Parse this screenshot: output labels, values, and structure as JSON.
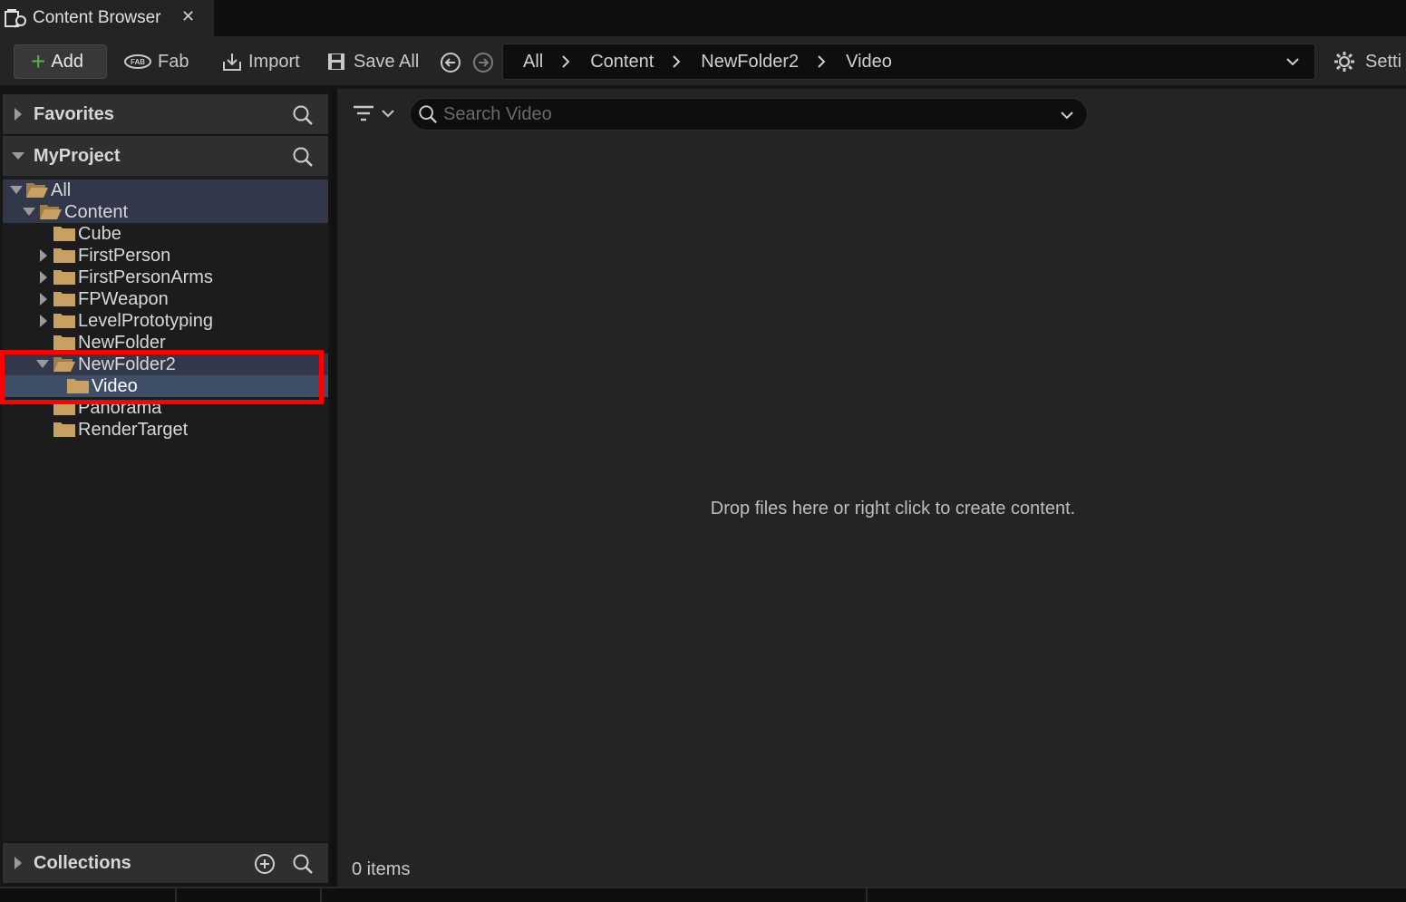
{
  "tab": {
    "title": "Content Browser",
    "close": "✕",
    "icon": "content-browser-icon"
  },
  "toolbar": {
    "add_label": "Add",
    "fab_label": "Fab",
    "import_label": "Import",
    "save_all_label": "Save All",
    "settings_label": "Setti"
  },
  "breadcrumb": {
    "items": [
      "All",
      "Content",
      "NewFolder2",
      "Video"
    ]
  },
  "left": {
    "favorites_label": "Favorites",
    "project_label": "MyProject",
    "collections_label": "Collections",
    "tree": [
      {
        "label": "All",
        "expanded": true,
        "has_children": true
      },
      {
        "label": "Content",
        "expanded": true,
        "has_children": true
      },
      {
        "label": "Cube",
        "has_children": false
      },
      {
        "label": "FirstPerson",
        "has_children": true
      },
      {
        "label": "FirstPersonArms",
        "has_children": true
      },
      {
        "label": "FPWeapon",
        "has_children": true
      },
      {
        "label": "LevelPrototyping",
        "has_children": true
      },
      {
        "label": "NewFolder",
        "has_children": false
      },
      {
        "label": "NewFolder2",
        "expanded": true,
        "has_children": true
      },
      {
        "label": "Video",
        "has_children": false,
        "selected": true
      },
      {
        "label": "Panorama",
        "has_children": false
      },
      {
        "label": "RenderTarget",
        "has_children": false
      }
    ]
  },
  "right": {
    "search_placeholder": "Search Video",
    "drop_hint": "Drop files here or right click to create content.",
    "items_count": "0 items"
  },
  "colors": {
    "accent_green": "#56b04a",
    "selection": "#3f4f68",
    "folder": "#c8a063",
    "highlight": "#ff0000"
  }
}
